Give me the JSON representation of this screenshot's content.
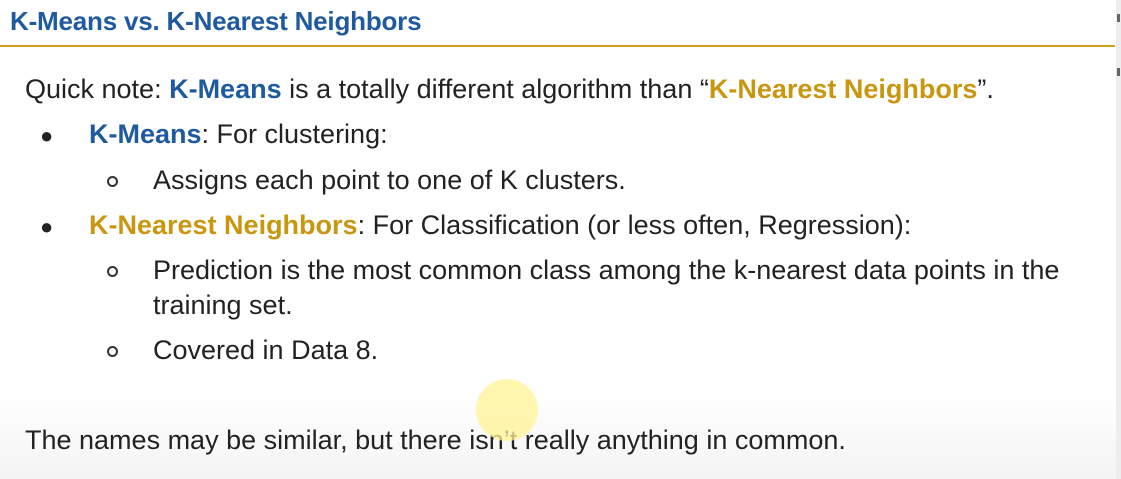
{
  "slide": {
    "title": "K-Means vs. K-Nearest Neighbors",
    "note": {
      "prefix": "Quick note: ",
      "kmeans": "K-Means",
      "middle": " is a totally different algorithm than “",
      "knn": "K-Nearest Neighbors",
      "suffix": "”."
    },
    "items": [
      {
        "term": "K-Means",
        "desc": ": For clustering:",
        "subs": [
          "Assigns each point to one of K clusters."
        ]
      },
      {
        "term": "K-Nearest Neighbors",
        "desc": ": For Classification (or less often, Regression):",
        "subs": [
          "Prediction is the most common class among the k-nearest data points in the",
          "training set.",
          "Covered in Data 8."
        ]
      }
    ],
    "footer": "The names may be similar, but there isn’t really anything in common."
  },
  "colors": {
    "title": "#1f5aa0",
    "rule": "#d29f1e",
    "kmeans": "#1f5aa0",
    "knn": "#c8960f"
  }
}
